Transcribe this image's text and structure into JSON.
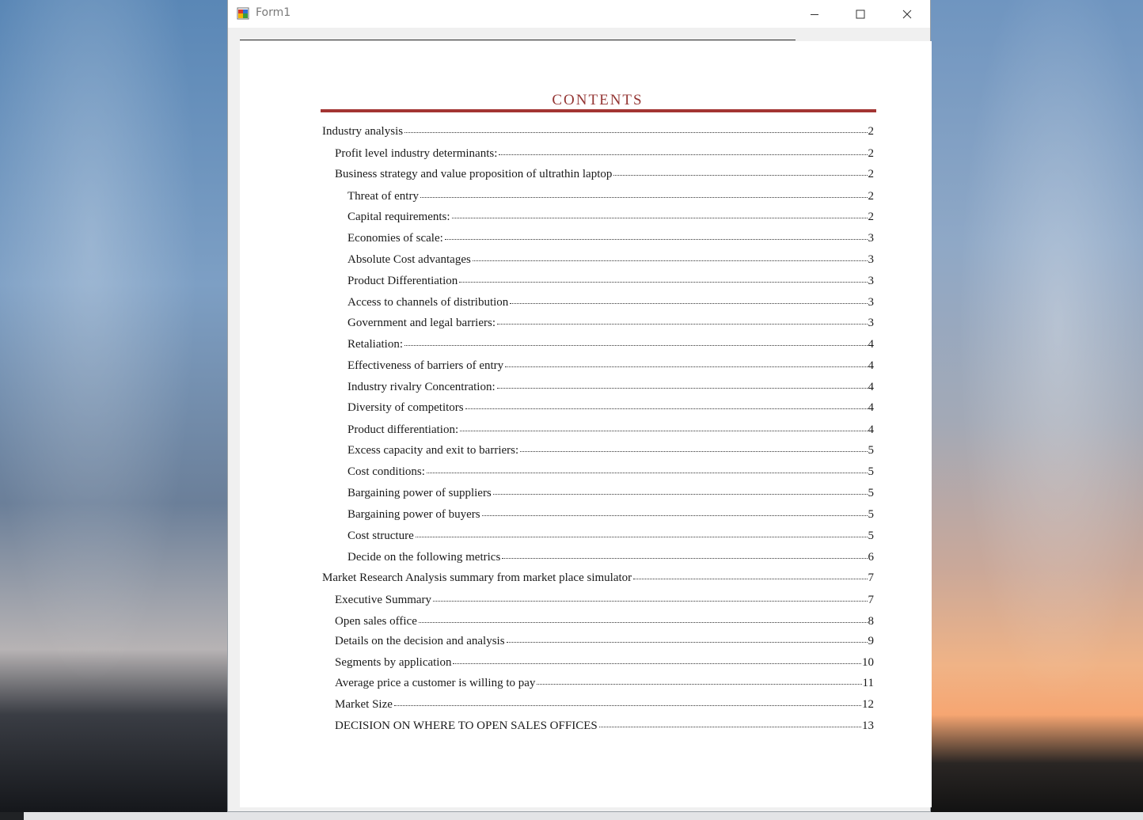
{
  "window": {
    "title": "Form1",
    "controls": {
      "minimize": "minimize",
      "maximize": "maximize",
      "close": "close"
    }
  },
  "document": {
    "heading": "CONTENTS",
    "entries": [
      {
        "text": "Industry analysis",
        "page": "2",
        "level": 1
      },
      {
        "text": "Profit level industry determinants:",
        "page": "2",
        "level": 2
      },
      {
        "text": "Business strategy and value proposition of ultrathin laptop",
        "page": "2",
        "level": 2
      },
      {
        "text": "Threat of entry",
        "page": "2",
        "level": 3
      },
      {
        "text": "Capital requirements:",
        "page": "2",
        "level": 3
      },
      {
        "text": "Economies of scale:",
        "page": "3",
        "level": 3
      },
      {
        "text": "Absolute Cost advantages",
        "page": "3",
        "level": 3
      },
      {
        "text": "Product Differentiation",
        "page": "3",
        "level": 3
      },
      {
        "text": "Access to channels of distribution",
        "page": "3",
        "level": 3
      },
      {
        "text": "Government and legal barriers:",
        "page": "3",
        "level": 3
      },
      {
        "text": "Retaliation:",
        "page": "4",
        "level": 3
      },
      {
        "text": "Effectiveness of barriers of entry",
        "page": "4",
        "level": 3
      },
      {
        "text": "Industry rivalry Concentration:",
        "page": "4",
        "level": 3
      },
      {
        "text": "Diversity of competitors",
        "page": "4",
        "level": 3
      },
      {
        "text": "Product differentiation:",
        "page": "4",
        "level": 3
      },
      {
        "text": "Excess capacity and exit to barriers:",
        "page": "5",
        "level": 3
      },
      {
        "text": "Cost conditions:",
        "page": "5",
        "level": 3
      },
      {
        "text": "Bargaining power of suppliers",
        "page": "5",
        "level": 3
      },
      {
        "text": "Bargaining power of buyers",
        "page": "5",
        "level": 3
      },
      {
        "text": "Cost structure",
        "page": "5",
        "level": 3
      },
      {
        "text": "Decide on the following metrics",
        "page": "6",
        "level": 3
      },
      {
        "text": "Market Research Analysis summary from market place simulator",
        "page": "7",
        "level": 1
      },
      {
        "text": "Executive Summary",
        "page": "7",
        "level": 2
      },
      {
        "text": "Open sales office",
        "page": "8",
        "level": 2
      },
      {
        "text": "Details on the decision and analysis",
        "page": "9",
        "level": 2
      },
      {
        "text": "Segments by application",
        "page": "10",
        "level": 2
      },
      {
        "text": "Average price a customer is willing to pay",
        "page": "11",
        "level": 2
      },
      {
        "text": "Market Size",
        "page": "12",
        "level": 2
      },
      {
        "text": "DECISION ON WHERE TO OPEN SALES OFFICES",
        "page": "13",
        "level": 2
      }
    ]
  },
  "colors": {
    "heading": "#943634",
    "rule": "#a33533"
  }
}
